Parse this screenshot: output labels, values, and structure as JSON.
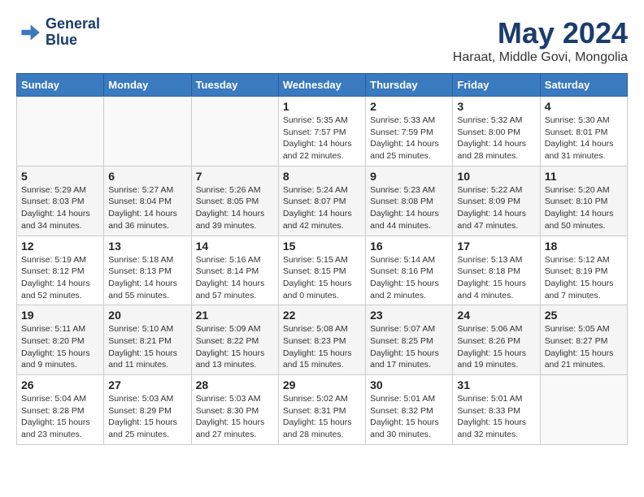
{
  "header": {
    "logo_line1": "General",
    "logo_line2": "Blue",
    "month_year": "May 2024",
    "location": "Haraat, Middle Govi, Mongolia"
  },
  "days_of_week": [
    "Sunday",
    "Monday",
    "Tuesday",
    "Wednesday",
    "Thursday",
    "Friday",
    "Saturday"
  ],
  "weeks": [
    [
      {
        "day": "",
        "info": ""
      },
      {
        "day": "",
        "info": ""
      },
      {
        "day": "",
        "info": ""
      },
      {
        "day": "1",
        "info": "Sunrise: 5:35 AM\nSunset: 7:57 PM\nDaylight: 14 hours\nand 22 minutes."
      },
      {
        "day": "2",
        "info": "Sunrise: 5:33 AM\nSunset: 7:59 PM\nDaylight: 14 hours\nand 25 minutes."
      },
      {
        "day": "3",
        "info": "Sunrise: 5:32 AM\nSunset: 8:00 PM\nDaylight: 14 hours\nand 28 minutes."
      },
      {
        "day": "4",
        "info": "Sunrise: 5:30 AM\nSunset: 8:01 PM\nDaylight: 14 hours\nand 31 minutes."
      }
    ],
    [
      {
        "day": "5",
        "info": "Sunrise: 5:29 AM\nSunset: 8:03 PM\nDaylight: 14 hours\nand 34 minutes."
      },
      {
        "day": "6",
        "info": "Sunrise: 5:27 AM\nSunset: 8:04 PM\nDaylight: 14 hours\nand 36 minutes."
      },
      {
        "day": "7",
        "info": "Sunrise: 5:26 AM\nSunset: 8:05 PM\nDaylight: 14 hours\nand 39 minutes."
      },
      {
        "day": "8",
        "info": "Sunrise: 5:24 AM\nSunset: 8:07 PM\nDaylight: 14 hours\nand 42 minutes."
      },
      {
        "day": "9",
        "info": "Sunrise: 5:23 AM\nSunset: 8:08 PM\nDaylight: 14 hours\nand 44 minutes."
      },
      {
        "day": "10",
        "info": "Sunrise: 5:22 AM\nSunset: 8:09 PM\nDaylight: 14 hours\nand 47 minutes."
      },
      {
        "day": "11",
        "info": "Sunrise: 5:20 AM\nSunset: 8:10 PM\nDaylight: 14 hours\nand 50 minutes."
      }
    ],
    [
      {
        "day": "12",
        "info": "Sunrise: 5:19 AM\nSunset: 8:12 PM\nDaylight: 14 hours\nand 52 minutes."
      },
      {
        "day": "13",
        "info": "Sunrise: 5:18 AM\nSunset: 8:13 PM\nDaylight: 14 hours\nand 55 minutes."
      },
      {
        "day": "14",
        "info": "Sunrise: 5:16 AM\nSunset: 8:14 PM\nDaylight: 14 hours\nand 57 minutes."
      },
      {
        "day": "15",
        "info": "Sunrise: 5:15 AM\nSunset: 8:15 PM\nDaylight: 15 hours\nand 0 minutes."
      },
      {
        "day": "16",
        "info": "Sunrise: 5:14 AM\nSunset: 8:16 PM\nDaylight: 15 hours\nand 2 minutes."
      },
      {
        "day": "17",
        "info": "Sunrise: 5:13 AM\nSunset: 8:18 PM\nDaylight: 15 hours\nand 4 minutes."
      },
      {
        "day": "18",
        "info": "Sunrise: 5:12 AM\nSunset: 8:19 PM\nDaylight: 15 hours\nand 7 minutes."
      }
    ],
    [
      {
        "day": "19",
        "info": "Sunrise: 5:11 AM\nSunset: 8:20 PM\nDaylight: 15 hours\nand 9 minutes."
      },
      {
        "day": "20",
        "info": "Sunrise: 5:10 AM\nSunset: 8:21 PM\nDaylight: 15 hours\nand 11 minutes."
      },
      {
        "day": "21",
        "info": "Sunrise: 5:09 AM\nSunset: 8:22 PM\nDaylight: 15 hours\nand 13 minutes."
      },
      {
        "day": "22",
        "info": "Sunrise: 5:08 AM\nSunset: 8:23 PM\nDaylight: 15 hours\nand 15 minutes."
      },
      {
        "day": "23",
        "info": "Sunrise: 5:07 AM\nSunset: 8:25 PM\nDaylight: 15 hours\nand 17 minutes."
      },
      {
        "day": "24",
        "info": "Sunrise: 5:06 AM\nSunset: 8:26 PM\nDaylight: 15 hours\nand 19 minutes."
      },
      {
        "day": "25",
        "info": "Sunrise: 5:05 AM\nSunset: 8:27 PM\nDaylight: 15 hours\nand 21 minutes."
      }
    ],
    [
      {
        "day": "26",
        "info": "Sunrise: 5:04 AM\nSunset: 8:28 PM\nDaylight: 15 hours\nand 23 minutes."
      },
      {
        "day": "27",
        "info": "Sunrise: 5:03 AM\nSunset: 8:29 PM\nDaylight: 15 hours\nand 25 minutes."
      },
      {
        "day": "28",
        "info": "Sunrise: 5:03 AM\nSunset: 8:30 PM\nDaylight: 15 hours\nand 27 minutes."
      },
      {
        "day": "29",
        "info": "Sunrise: 5:02 AM\nSunset: 8:31 PM\nDaylight: 15 hours\nand 28 minutes."
      },
      {
        "day": "30",
        "info": "Sunrise: 5:01 AM\nSunset: 8:32 PM\nDaylight: 15 hours\nand 30 minutes."
      },
      {
        "day": "31",
        "info": "Sunrise: 5:01 AM\nSunset: 8:33 PM\nDaylight: 15 hours\nand 32 minutes."
      },
      {
        "day": "",
        "info": ""
      }
    ]
  ]
}
